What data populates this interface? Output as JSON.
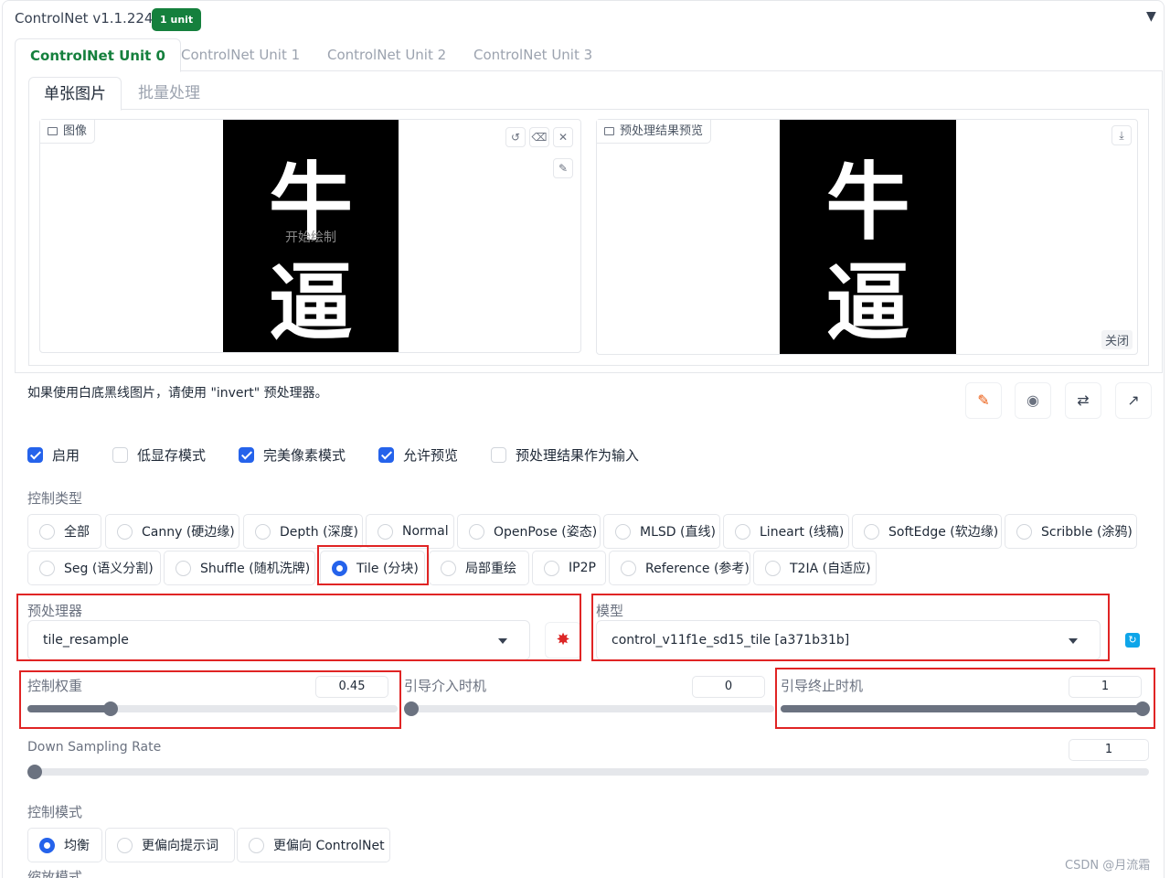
{
  "header": {
    "title": "ControlNet v1.1.224",
    "badge": "1 unit",
    "collapse_icon": "triangle-down"
  },
  "unit_tabs": [
    "ControlNet Unit 0",
    "ControlNet Unit 1",
    "ControlNet Unit 2",
    "ControlNet Unit 3"
  ],
  "image_tabs": [
    "单张图片",
    "批量处理"
  ],
  "input_image": {
    "label": "图像",
    "glyph_top": "牛",
    "glyph_bottom": "逼",
    "overlay": "开始绘制"
  },
  "preview_image": {
    "label": "预处理结果预览",
    "glyph_top": "牛",
    "glyph_bottom": "逼",
    "close": "关闭"
  },
  "hint": "如果使用白底黑线图片，请使用 \"invert\" 预处理器。",
  "checkboxes": [
    {
      "label": "启用",
      "checked": true
    },
    {
      "label": "低显存模式",
      "checked": false
    },
    {
      "label": "完美像素模式",
      "checked": true
    },
    {
      "label": "允许预览",
      "checked": true
    },
    {
      "label": "预处理结果作为输入",
      "checked": false
    }
  ],
  "control_type": {
    "label": "控制类型",
    "row1": [
      "全部",
      "Canny (硬边缘)",
      "Depth (深度)",
      "Normal",
      "OpenPose (姿态)",
      "MLSD (直线)",
      "Lineart (线稿)",
      "SoftEdge (软边缘)",
      "Scribble (涂鸦)"
    ],
    "row2": [
      "Seg (语义分割)",
      "Shuffle (随机洗牌)",
      "Tile (分块)",
      "局部重绘",
      "IP2P",
      "Reference (参考)",
      "T2IA (自适应)"
    ],
    "selected": "Tile (分块)"
  },
  "preprocessor": {
    "label": "预处理器",
    "value": "tile_resample"
  },
  "model": {
    "label": "模型",
    "value": "control_v11f1e_sd15_tile [a371b31b]"
  },
  "sliders": {
    "weight": {
      "label": "控制权重",
      "value": "0.45",
      "fraction": 0.225
    },
    "start": {
      "label": "引导介入时机",
      "value": "0",
      "fraction": 0
    },
    "end": {
      "label": "引导终止时机",
      "value": "1",
      "fraction": 1
    },
    "down_sampling": {
      "label": "Down Sampling Rate",
      "value": "1",
      "fraction": 0
    }
  },
  "control_mode": {
    "label": "控制模式",
    "options": [
      "均衡",
      "更偏向提示词",
      "更偏向 ControlNet"
    ],
    "selected": "均衡"
  },
  "resize_mode_label": "缩放模式",
  "watermark": "CSDN @月流霜"
}
